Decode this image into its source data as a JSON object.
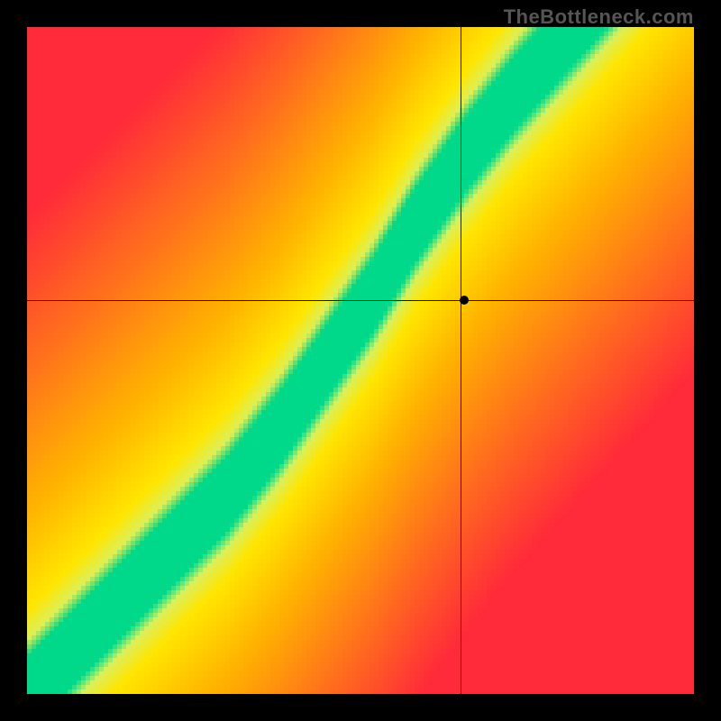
{
  "watermark": "TheBottleneck.com",
  "chart_data": {
    "type": "heatmap",
    "title": "",
    "xlabel": "",
    "ylabel": "",
    "xlim": [
      0,
      1
    ],
    "ylim": [
      0,
      1
    ],
    "color_scale": {
      "low": "#ff2a3a",
      "mid_low": "#ffb400",
      "mid": "#ffe600",
      "optimal": "#00d98a",
      "description": "red = heavy bottleneck, orange/yellow = moderate, green = balanced"
    },
    "optimal_curve": {
      "comment": "points (x,y) in normalized [0,1] coords along the green balanced ridge, y measured from bottom",
      "points": [
        [
          0.0,
          0.0
        ],
        [
          0.1,
          0.1
        ],
        [
          0.2,
          0.2
        ],
        [
          0.3,
          0.3
        ],
        [
          0.38,
          0.4
        ],
        [
          0.45,
          0.5
        ],
        [
          0.52,
          0.6
        ],
        [
          0.58,
          0.7
        ],
        [
          0.65,
          0.8
        ],
        [
          0.73,
          0.9
        ],
        [
          0.82,
          1.0
        ]
      ],
      "band_halfwidth": 0.035
    },
    "crosshair": {
      "x": 0.65,
      "y_from_top": 0.41
    },
    "marker": {
      "x": 0.655,
      "y_from_top": 0.41
    },
    "grid_resolution": 148
  }
}
